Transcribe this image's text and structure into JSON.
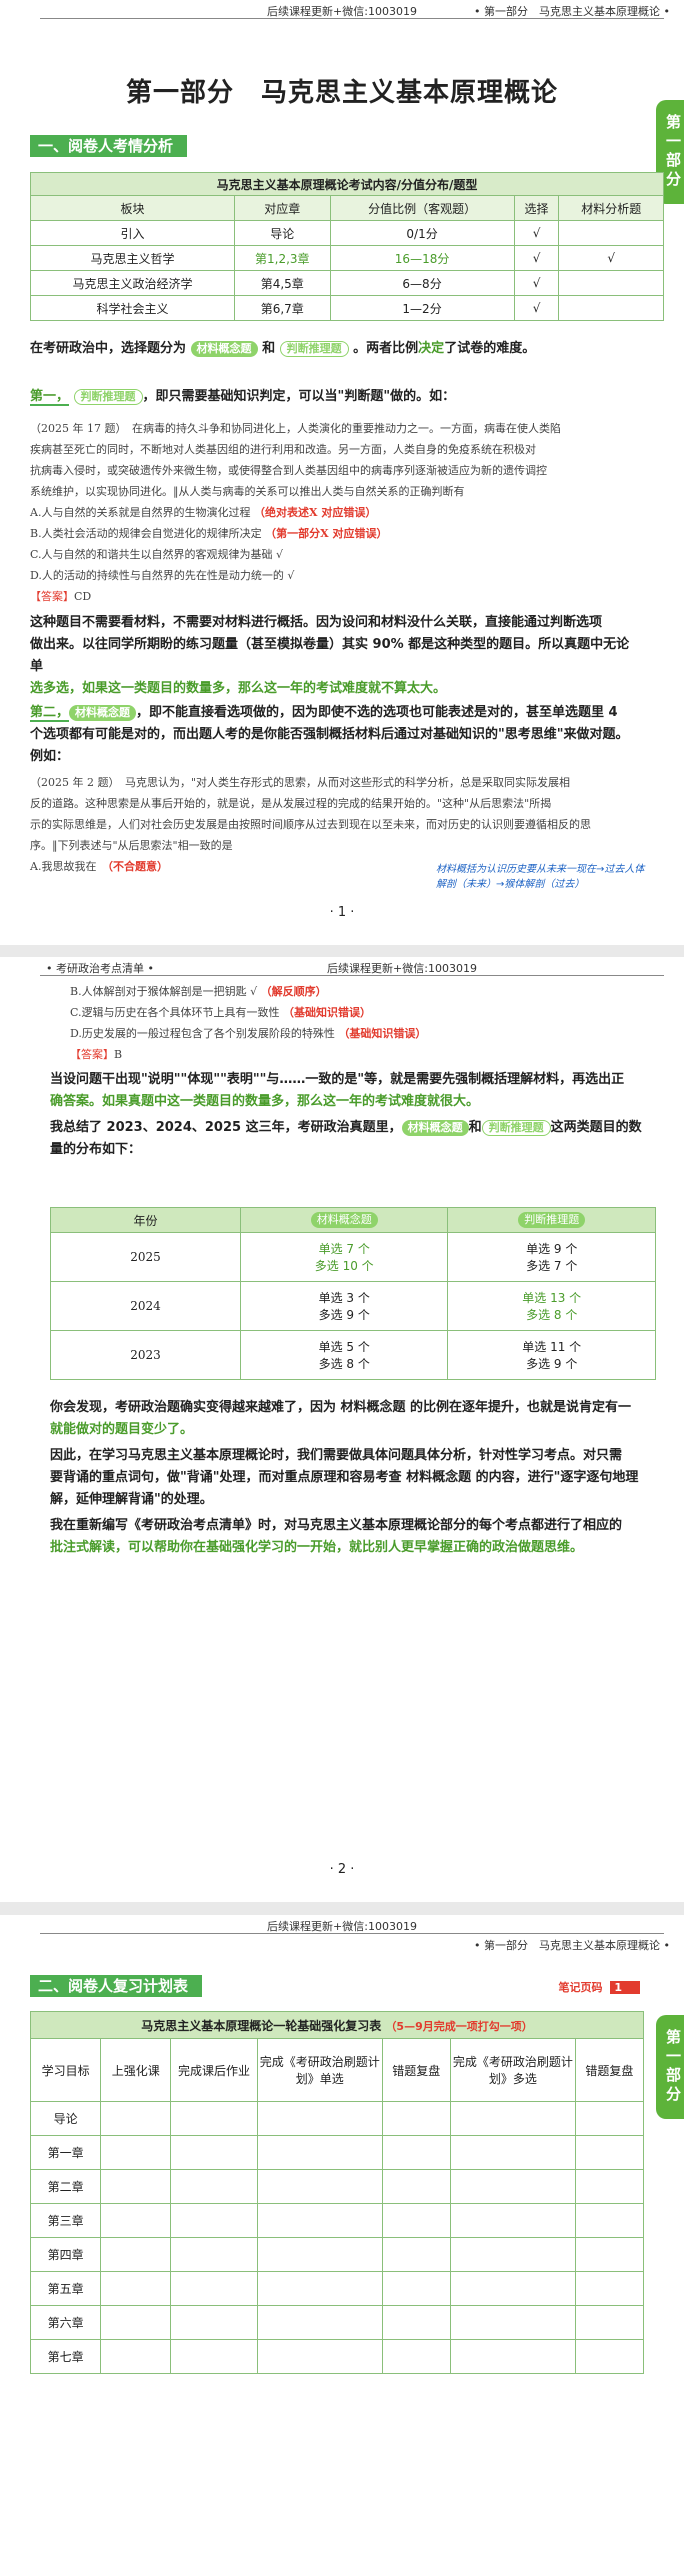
{
  "page1": {
    "header_center": "后续课程更新+微信:1003019",
    "header_right": "• 第一部分　马克思主义基本原理概论 •",
    "title": "第一部分　马克思主义基本原理概论",
    "side_tab": "第一部分",
    "section1": "一、阅卷人考情分析",
    "table_caption": "马克思主义基本原理概论考试内容/分值分布/题型",
    "table_headers": [
      "板块",
      "对应章",
      "分值比例（客观题）",
      "选择",
      "材料分析题"
    ],
    "table_rows": [
      {
        "c1": "引入",
        "c2": "导论",
        "c3": "0/1分",
        "c4": "√",
        "c5": ""
      },
      {
        "c1": "马克思主义哲学",
        "c2": "第1,2,3章",
        "c3": "16—18分",
        "c4": "√",
        "c5": "√"
      },
      {
        "c1": "马克思主义政治经济学",
        "c2": "第4,5章",
        "c3": "6—8分",
        "c4": "√",
        "c5": ""
      },
      {
        "c1": "科学社会主义",
        "c2": "第6,7章",
        "c3": "1—2分",
        "c4": "√",
        "c5": ""
      }
    ],
    "p_intro_a": "在考研政治中，选择题分为",
    "pill_single": "材料概念题",
    "p_intro_b": "和",
    "pill_multi": "判断推理题",
    "p_intro_c": "。两者比例",
    "p_intro_d": "决定",
    "p_intro_e": "了试卷的难度。",
    "first_label": "第一，",
    "first_pill": "判断推理题",
    "first_text": "，即只需要基础知识判定，可以当\"判断题\"做的。如：",
    "q1_lines": [
      "（2025 年 17 题）　在病毒的持久斗争和协同进化上，人类演化的重要推动力之一。一方面，病毒在使人类陷",
      "疾病甚至死亡的同时，不断地对人类基因组的进行利用和改造。另一方面，人类自身的免疫系统在积极对",
      "抗病毒入侵时，或突破遗传外来微生物，或使得整合到人类基因组中的病毒序列逐渐被适应为新的遗传调控",
      "系统维护，以实现协同进化。‖从人类与病毒的关系可以推出人类与自然关系的正确判断有"
    ],
    "q1_options": [
      {
        "text": "A.人与自然的关系就是自然界的生物演化过程",
        "note": "（绝对表述X 对应错误）"
      },
      {
        "text": "B.人类社会活动的规律会自觉进化的规律所决定",
        "note": "（第一部分X 对应错误）"
      },
      {
        "text": "C.人与自然的和谐共生以自然界的客观规律为基础 √",
        "note": ""
      },
      {
        "text": "D.人的活动的持续性与自然界的先在性是动力统一的 √",
        "note": ""
      }
    ],
    "answer_label": "【答案】",
    "answer1": "CD",
    "p2_lines": [
      "这种题目不需要看材料，不需要对材料进行概括。因为设问和材料没什么关联，直接能通过判断选项",
      "做出来。以往同学所期盼的练习题量（甚至模拟卷量）其实 90% 都是这种类型的题目。所以真题中无论单",
      "选多选，如果这一类题目的数量多，那么这一年的考试难度就不算太大。"
    ],
    "second_label": "第二，",
    "second_pill": "材料概念题",
    "second_text_lines": [
      "，即不能直接看选项做的，因为即使不选的选项也可能表述是对的，甚至单选题里 4",
      "个选项都有可能是对的，而出题人考的是你能否强制概括材料后通过对基础知识的\"思考思维\"来做对题。",
      "例如："
    ],
    "q2_lines": [
      "（2025 年 2 题）　马克思认为，\"对人类生存形式的思索，从而对这些形式的科学分析，总是采取同实际发展相",
      "反的道路。这种思索是从事后开始的，就是说，是从发展过程的完成的结果开始的。\"这种\"从后思索法\"所揭",
      "示的实际思维是，人们对社会历史发展是由按照时间顺序从过去到现在以至未来，而对历史的认识则要遵循相反的思",
      "序。‖下列表述与\"从后思索法\"相一致的是"
    ],
    "q2_option_a": "A.我思故我在",
    "q2_option_a_note": "（不合题意）",
    "handwriting": "材料概括为认识历史要从未来一现在→过去人体解剖（未来）→猴体解剖（过去）",
    "page_number": "· 1 ·"
  },
  "page2": {
    "header_left": "• 考研政治考点清单 •",
    "header_center": "后续课程更新+微信:1003019",
    "options": [
      {
        "text": "B.人体解剖对于猴体解剖是一把钥匙 √",
        "note": "（解反顺序）"
      },
      {
        "text": "C.逻辑与历史在各个具体环节上具有一致性",
        "note": "（基础知识错误）"
      },
      {
        "text": "D.历史发展的一般过程包含了各个别发展阶段的特殊性",
        "note": "（基础知识错误）"
      }
    ],
    "answer_label": "【答案】",
    "answer": "B",
    "para1_lines": [
      "当设问题干出现\"说明\"\"体现\"\"表明\"\"与……一致的是\"等，就是需要先强制概括理解材料，再选出正",
      "确答案。如果真题中这一类题目的数量多，那么这一年的考试难度就很大。"
    ],
    "para2_a": "我总结了 2023、2024、2025 这三年，考研政治真题里，",
    "para2_pill1": "材料概念题",
    "para2_b": "和",
    "para2_pill2": "判断推理题",
    "para2_c": "这两类题目的数",
    "para2_d": "量的分布如下：",
    "table_headers": [
      "年份",
      "材料概念题",
      "判断推理题"
    ],
    "table_rows": [
      {
        "year": "2025",
        "a1": "单选 7 个",
        "a2": "多选 10 个",
        "b1": "单选 9 个",
        "b2": "多选 7 个"
      },
      {
        "year": "2024",
        "a1": "单选 3 个",
        "a2": "多选 9 个",
        "b1": "单选 13 个",
        "b2": "多选 8 个"
      },
      {
        "year": "2023",
        "a1": "单选 5 个",
        "a2": "多选 8 个",
        "b1": "单选 11 个",
        "b2": "多选 9 个"
      }
    ],
    "para3_lines": [
      "你会发现，考研政治题确实变得越来越难了，因为 材料概念题 的比例在逐年提升，也就是说肯定有一",
      "就能做对的题目变少了。"
    ],
    "para4_lines": [
      "因此，在学习马克思主义基本原理概论时，我们需要做具体问题具体分析，针对性学习考点。对只需",
      "要背诵的重点词句，做\"背诵\"处理，而对重点原理和容易考查 材料概念题 的内容，进行\"逐字逐句地理",
      "解，延伸理解背诵\"的处理。"
    ],
    "para5_lines": [
      "我在重新编写《考研政治考点清单》时，对马克思主义基本原理概论部分的每个考点都进行了相应的",
      "批注式解读，可以帮助你在基础强化学习的一开始，就比别人更早掌握正确的政治做题思维。"
    ],
    "page_number": "· 2 ·"
  },
  "page3": {
    "header_center": "后续课程更新+微信:1003019",
    "header_right": "• 第一部分　马克思主义基本原理概论 •",
    "section2": "二、阅卷人复习计划表",
    "notes_code": "笔记页码",
    "notes_code_value": "1",
    "side_tab": "第一部分",
    "table_caption": "马克思主义基本原理概论一轮基础强化复习表",
    "table_caption_note": "（5—9月完成一项打勾一项）",
    "table_headers": [
      "学习目标",
      "上强化课",
      "完成课后作业",
      "完成《考研政治刷题计划》单选",
      "错题复盘",
      "完成《考研政治刷题计划》多选",
      "错题复盘"
    ],
    "rows": [
      "导论",
      "第一章",
      "第二章",
      "第三章",
      "第四章",
      "第五章",
      "第六章",
      "第七章"
    ]
  },
  "colors": {
    "accent_green": "#4caf50",
    "pill_green": "#8fd36a",
    "note_red": "#e23b2e",
    "handwriting_blue": "#1e63c4"
  }
}
